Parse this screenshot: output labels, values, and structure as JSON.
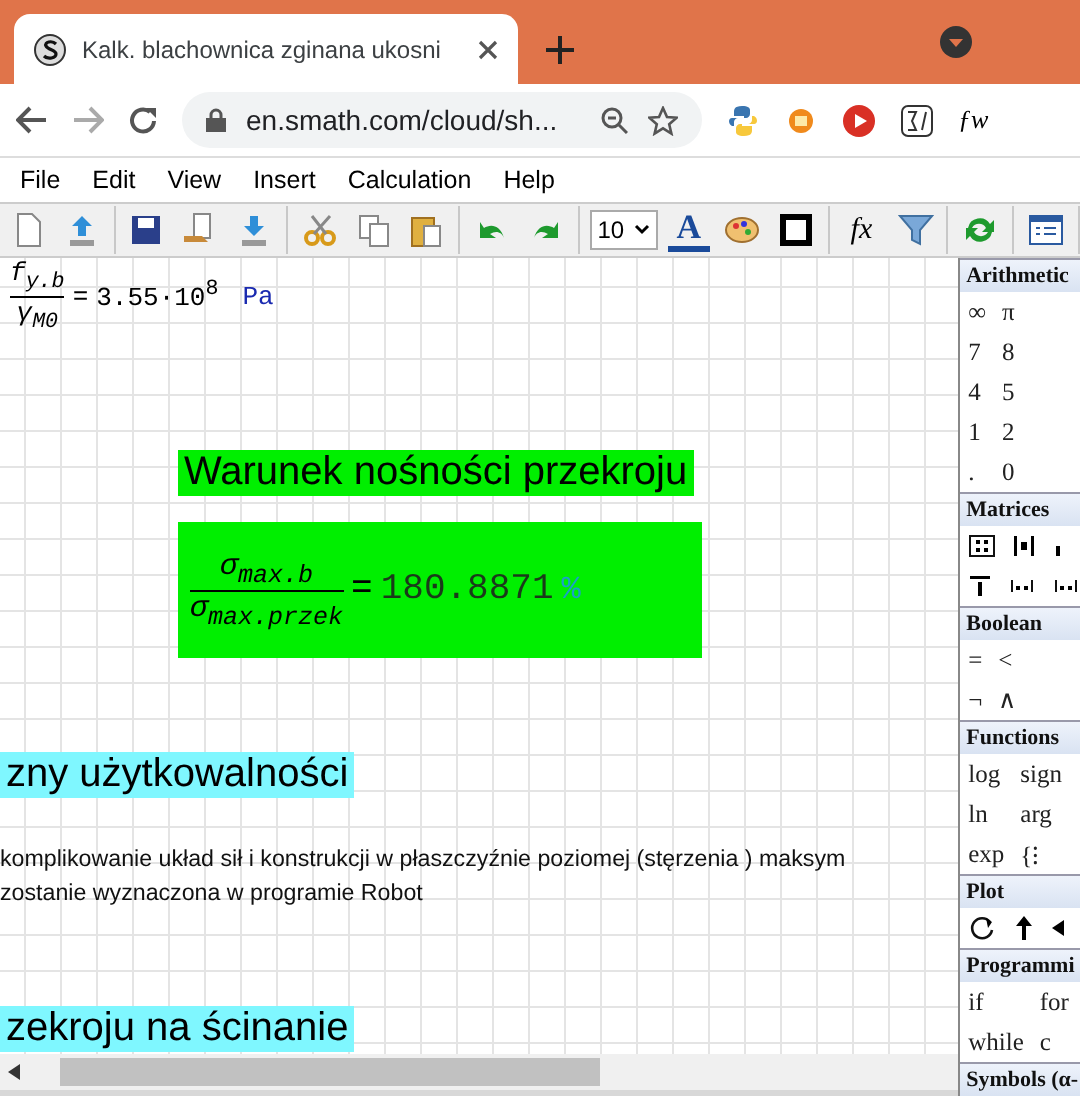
{
  "browser": {
    "tab_title": "Kalk. blachownica zginana ukosni",
    "url": "en.smath.com/cloud/sh...",
    "extension_text": "ƒw"
  },
  "menu": [
    "File",
    "Edit",
    "View",
    "Insert",
    "Calculation",
    "Help"
  ],
  "toolbar": {
    "font_size": "10",
    "font_color_label": "A",
    "fx_label": "fx"
  },
  "worksheet": {
    "formula": {
      "numerator": "f",
      "numerator_sub": "y.b",
      "denominator": "γ",
      "denominator_sub": "M0",
      "equals": "=",
      "result": "3.55·10",
      "exponent": "8",
      "unit": "Pa"
    },
    "heading_green": "Warunek nośności przekroju",
    "ratio": {
      "numerator": "σ",
      "numerator_sub": "max.b",
      "denominator": "σ",
      "denominator_sub": "max.przek",
      "equals": "=",
      "result": "180.8871",
      "unit": "%"
    },
    "heading_cyan_1": "zny użytkowalności",
    "paragraph": [
      "komplikowanie układ sił i konstrukcji w płaszczyźnie poziomej (stęrzenia ) maksym",
      "zostanie wyznaczona w programie Robot"
    ],
    "heading_cyan_2": "zekroju na ścinanie"
  },
  "palette": [
    {
      "title": "Arithmetic",
      "kind": "text",
      "rows": [
        [
          "∞",
          "π"
        ],
        [
          "7",
          "8"
        ],
        [
          "4",
          "5"
        ],
        [
          "1",
          "2"
        ],
        [
          ".",
          "0"
        ]
      ]
    },
    {
      "title": "Matrices",
      "kind": "matrix_icons"
    },
    {
      "title": "Boolean",
      "kind": "text",
      "rows": [
        [
          "=",
          "<"
        ],
        [
          "¬",
          "∧"
        ]
      ]
    },
    {
      "title": "Functions",
      "kind": "text",
      "rows": [
        [
          "log",
          "sign"
        ],
        [
          "ln",
          "arg"
        ],
        [
          "exp",
          "{⁝"
        ]
      ]
    },
    {
      "title": "Plot",
      "kind": "plot_icons"
    },
    {
      "title": "Programmi",
      "kind": "text",
      "rows": [
        [
          "if",
          "for"
        ],
        [
          "while",
          "c"
        ]
      ]
    },
    {
      "title": "Symbols (α-",
      "kind": "text"
    }
  ]
}
